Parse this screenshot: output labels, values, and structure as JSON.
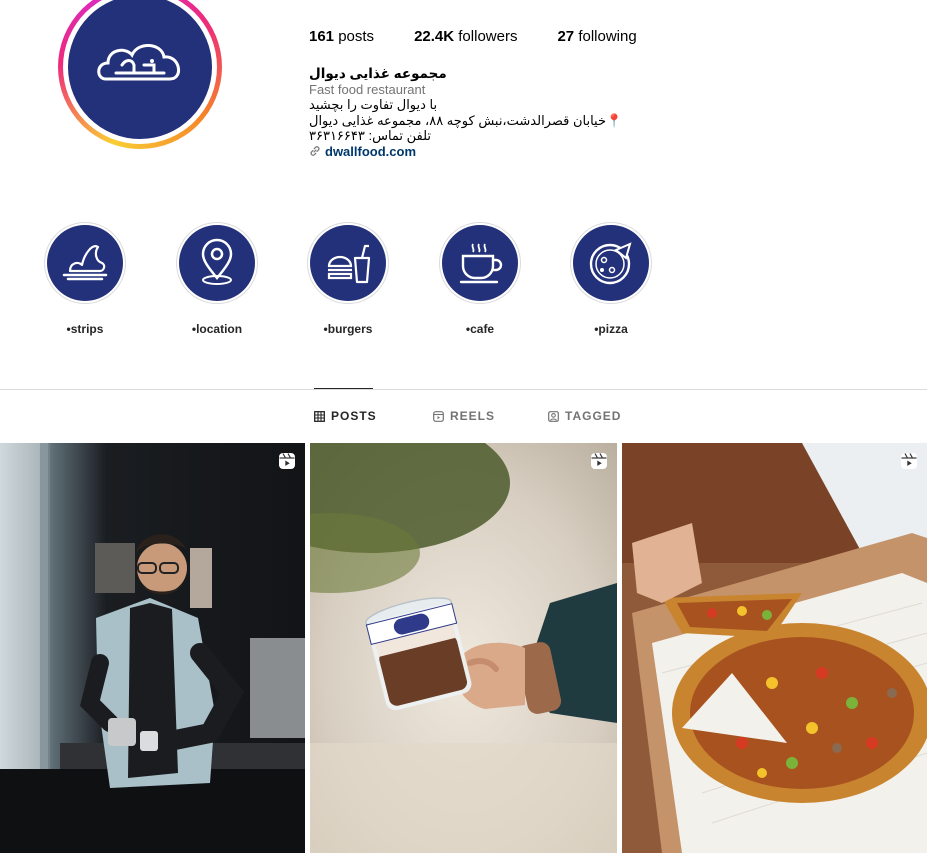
{
  "profile": {
    "posts_count": "161",
    "posts_label": "posts",
    "followers_count": "22.4K",
    "followers_label": "followers",
    "following_count": "27",
    "following_label": "following",
    "name": "مجموعه غذایی دیوال",
    "category": "Fast food restaurant",
    "bio_line1": "با دیوال تفاوت را بچشید",
    "bio_line2": "📍خیابان قصرالدشت،نبش کوچه ۸۸، مجموعه غذایی دیوال",
    "bio_line3": "تلفن تماس: ۳۶۳۱۶۶۴۳",
    "website": "dwallfood.com",
    "logo_text": "دیوال"
  },
  "highlights": [
    {
      "label": "•strips",
      "icon": "food-plate-icon"
    },
    {
      "label": "•location",
      "icon": "location-pin-icon"
    },
    {
      "label": "•burgers",
      "icon": "burger-drink-icon"
    },
    {
      "label": "•cafe",
      "icon": "coffee-cup-icon"
    },
    {
      "label": "•pizza",
      "icon": "pizza-icon"
    }
  ],
  "tabs": [
    {
      "label": "POSTS",
      "icon": "grid-icon",
      "active": true
    },
    {
      "label": "REELS",
      "icon": "reels-icon",
      "active": false
    },
    {
      "label": "TAGGED",
      "icon": "tagged-icon",
      "active": false
    }
  ],
  "colors": {
    "brand_navy": "#23307a",
    "link": "#00376b",
    "muted": "#737373",
    "divider": "#dbdbdb"
  },
  "posts": [
    {
      "type": "reel",
      "icon": "reels-icon",
      "description_icon": "barista-photo"
    },
    {
      "type": "reel",
      "icon": "reels-icon",
      "description_icon": "dessert-jar-photo"
    },
    {
      "type": "reel",
      "icon": "reels-icon",
      "description_icon": "pizza-photo"
    }
  ]
}
